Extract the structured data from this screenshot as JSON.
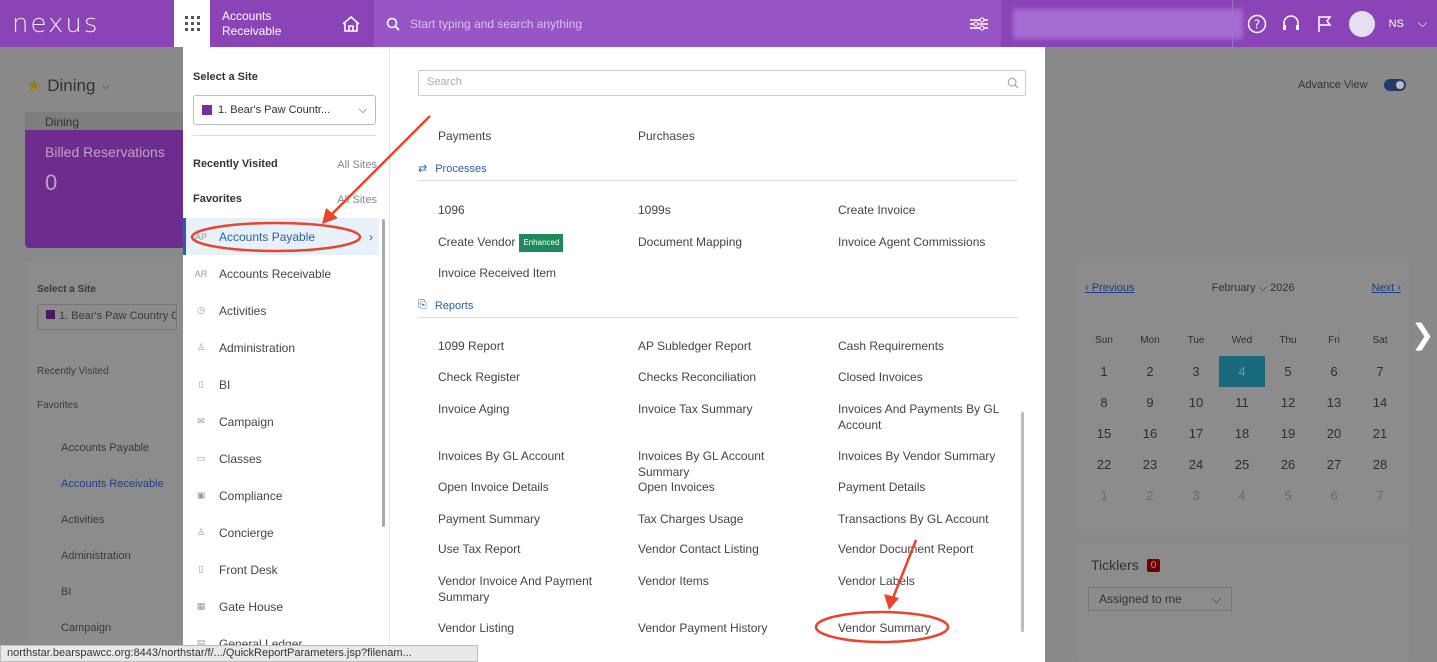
{
  "topbar": {
    "logo": "nexus",
    "module_name": "Accounts Receivable",
    "search_placeholder": "Start typing and search anything",
    "user_initials": "NS"
  },
  "page": {
    "title": "Dining",
    "card_tab": "Dining",
    "card_label": "Billed Reservations",
    "card_value": "0",
    "left": {
      "select_site": "Select a Site",
      "site_value": "1. Bear's Paw Country Cl",
      "recently_visited": "Recently Visited",
      "favorites": "Favorites",
      "items": [
        "Accounts Payable",
        "Accounts Receivable",
        "Activities",
        "Administration",
        "BI",
        "Campaign"
      ]
    },
    "advance_view": "Advance View",
    "calendar": {
      "prev": "Previous",
      "month": "February",
      "year": "2026",
      "next": "Next",
      "dow": [
        "Sun",
        "Mon",
        "Tue",
        "Wed",
        "Thu",
        "Fri",
        "Sat"
      ],
      "days": [
        "1",
        "2",
        "3",
        "4",
        "5",
        "6",
        "7",
        "8",
        "9",
        "10",
        "11",
        "12",
        "13",
        "14",
        "15",
        "16",
        "17",
        "18",
        "19",
        "20",
        "21",
        "22",
        "23",
        "24",
        "25",
        "26",
        "27",
        "28",
        "1",
        "2",
        "3",
        "4",
        "5",
        "6",
        "7"
      ],
      "today": "4"
    },
    "ticklers": {
      "title": "Ticklers",
      "count": "0",
      "assigned": "Assigned to me"
    }
  },
  "menu": {
    "select_site": "Select a Site",
    "site_value": "1. Bear's Paw Countr...",
    "recently_visited": "Recently Visited",
    "favorites": "Favorites",
    "all_sites": "All Sites",
    "modules": [
      {
        "label": "Accounts Payable",
        "icon": "AP"
      },
      {
        "label": "Accounts Receivable",
        "icon": "AR"
      },
      {
        "label": "Activities",
        "icon": "◷"
      },
      {
        "label": "Administration",
        "icon": "♙"
      },
      {
        "label": "BI",
        "icon": "▯"
      },
      {
        "label": "Campaign",
        "icon": "✉"
      },
      {
        "label": "Classes",
        "icon": "▭"
      },
      {
        "label": "Compliance",
        "icon": "▣"
      },
      {
        "label": "Concierge",
        "icon": "♙"
      },
      {
        "label": "Front Desk",
        "icon": "▯"
      },
      {
        "label": "Gate House",
        "icon": "▦"
      },
      {
        "label": "General Ledger",
        "icon": "▤"
      }
    ],
    "search_placeholder": "Search",
    "top_links": [
      "Payments",
      "Purchases"
    ],
    "processes_title": "Processes",
    "processes": [
      "1096",
      "1099s",
      "Create Invoice",
      "Create Vendor",
      "Document Mapping",
      "Invoice Agent Commissions",
      "Invoice Received Item"
    ],
    "enhanced_badge": "Enhanced",
    "reports_title": "Reports",
    "reports": [
      "1099 Report",
      "AP Subledger Report",
      "Cash Requirements",
      "Check Register",
      "Checks Reconciliation",
      "Closed Invoices",
      "Invoice Aging",
      "Invoice Tax Summary",
      "Invoices And Payments By GL Account",
      "Invoices By GL Account",
      "Invoices By GL Account Summary",
      "Invoices By Vendor Summary",
      "Open Invoice Details",
      "Open Invoices",
      "Payment Details",
      "Payment Summary",
      "Tax Charges Usage",
      "Transactions By GL Account",
      "Use Tax Report",
      "Vendor Contact Listing",
      "Vendor Document Report",
      "Vendor Invoice And Payment Summary",
      "Vendor Items",
      "Vendor Labels",
      "Vendor Listing",
      "Vendor Payment History",
      "Vendor Summary"
    ]
  },
  "status_url": "northstar.bearspawcc.org:8443/northstar/f/.../QuickReportParameters.jsp?filenam...",
  "colors": {
    "brand": "#8a44b8",
    "annotation": "#e8452c",
    "link": "#2a5fa8"
  }
}
